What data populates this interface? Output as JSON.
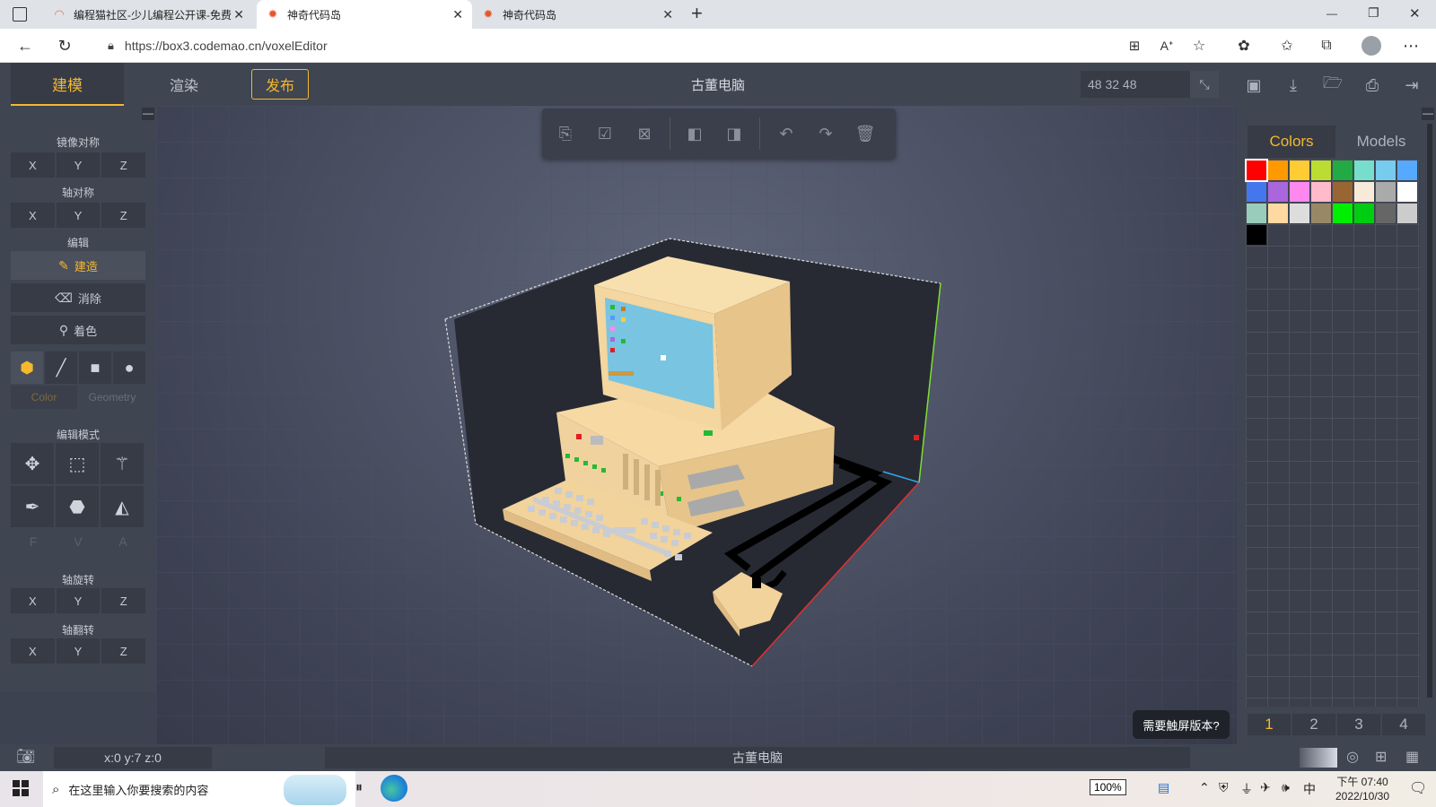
{
  "browser": {
    "tabs": [
      {
        "title": "编程猫社区-少儿编程公开课-免费",
        "active": false
      },
      {
        "title": "神奇代码岛",
        "active": true
      },
      {
        "title": "神奇代码岛",
        "active": false
      }
    ],
    "new_tab": "+",
    "url": "https://box3.codemao.cn/voxelEditor",
    "window_buttons": {
      "minimize": "—",
      "restore": "❐",
      "close": "✕"
    }
  },
  "app": {
    "nav": {
      "build": "建模",
      "render": "渲染",
      "publish": "发布"
    },
    "title": "古董电脑",
    "dimensions": "48  32  48"
  },
  "left_panel": {
    "mirror": {
      "label": "镜像对称",
      "axes": [
        "X",
        "Y",
        "Z"
      ]
    },
    "axis_sym": {
      "label": "轴对称",
      "axes": [
        "X",
        "Y",
        "Z"
      ]
    },
    "edit": {
      "label": "编辑",
      "build": "建造",
      "erase": "消除",
      "paint": "着色"
    },
    "tabs": {
      "color": "Color",
      "geometry": "Geometry"
    },
    "edit_mode": {
      "label": "编辑模式",
      "fva": [
        "F",
        "V",
        "A"
      ]
    },
    "axis_rotate": {
      "label": "轴旋转",
      "axes": [
        "X",
        "Y",
        "Z"
      ]
    },
    "axis_flip": {
      "label": "轴翻转",
      "axes": [
        "X",
        "Y",
        "Z"
      ]
    }
  },
  "right_panel": {
    "tabs": {
      "colors": "Colors",
      "models": "Models"
    },
    "palette": [
      "#ff0000",
      "#ff9900",
      "#ffcc33",
      "#bbdd33",
      "#22aa44",
      "#77ddcc",
      "#77ccee",
      "#55aaff",
      "#4477ee",
      "#aa66dd",
      "#ff88ee",
      "#ffbbcc",
      "#996633",
      "#f8ead8",
      "#aaaaaa",
      "#ffffff",
      "#99ccbb",
      "#ffd9a0",
      "#dddddd",
      "#998866",
      "#00ee00",
      "#00cc11",
      "#666666",
      "#cccccc",
      "#000000"
    ],
    "pages": [
      "1",
      "2",
      "3",
      "4"
    ]
  },
  "touch_tip": "需要触屏版本?",
  "status": {
    "coords": "x:0  y:7  z:0",
    "title": "古董电脑"
  },
  "taskbar": {
    "search_placeholder": "在这里输入你要搜索的内容",
    "battery": "100%",
    "ime": "中",
    "time": "下午 07:40",
    "date": "2022/10/30"
  }
}
